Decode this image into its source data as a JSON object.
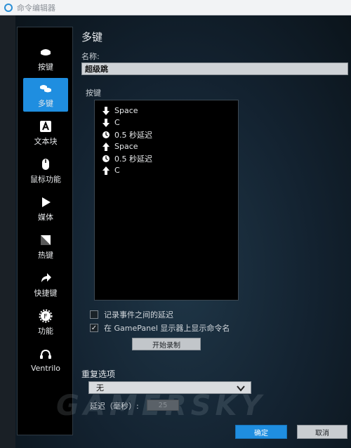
{
  "window": {
    "title": "命令编辑器"
  },
  "sidebar": {
    "items": [
      {
        "label": "按键",
        "icon": "key-icon",
        "active": false
      },
      {
        "label": "多键",
        "icon": "multi-key-icon",
        "active": true
      },
      {
        "label": "文本块",
        "icon": "text-block-icon",
        "active": false
      },
      {
        "label": "鼠标功能",
        "icon": "mouse-icon",
        "active": false
      },
      {
        "label": "媒体",
        "icon": "play-icon",
        "active": false
      },
      {
        "label": "热键",
        "icon": "hotkey-icon",
        "active": false
      },
      {
        "label": "快捷键",
        "icon": "shortcut-arrow-icon",
        "active": false
      },
      {
        "label": "功能",
        "icon": "function-gear-icon",
        "active": false
      },
      {
        "label": "Ventrilo",
        "icon": "headset-icon",
        "active": false
      }
    ]
  },
  "main": {
    "section_title": "多键",
    "name_label": "名称:",
    "name_value": "超级跳",
    "keys_label": "按键",
    "keys": [
      {
        "icon": "arrow-down-icon",
        "text": "Space"
      },
      {
        "icon": "arrow-down-icon",
        "text": "C"
      },
      {
        "icon": "clock-icon",
        "text": "0.5 秒延迟"
      },
      {
        "icon": "arrow-up-icon",
        "text": "Space"
      },
      {
        "icon": "clock-icon",
        "text": "0.5 秒延迟"
      },
      {
        "icon": "arrow-up-icon",
        "text": "C"
      }
    ],
    "record_delay_label": "记录事件之间的延迟",
    "record_delay_checked": false,
    "show_name_label": "在 GamePanel 显示器上显示命令名",
    "show_name_checked": true,
    "record_button": "开始录制",
    "repeat_title": "重复选项",
    "repeat_value": "无",
    "delay_label": "延迟（毫秒）:",
    "delay_value": "25"
  },
  "footer": {
    "ok": "确定",
    "cancel": "取消"
  },
  "watermark": "GAMERSKY",
  "colors": {
    "accent": "#1f8ee0",
    "panel": "#000000"
  }
}
